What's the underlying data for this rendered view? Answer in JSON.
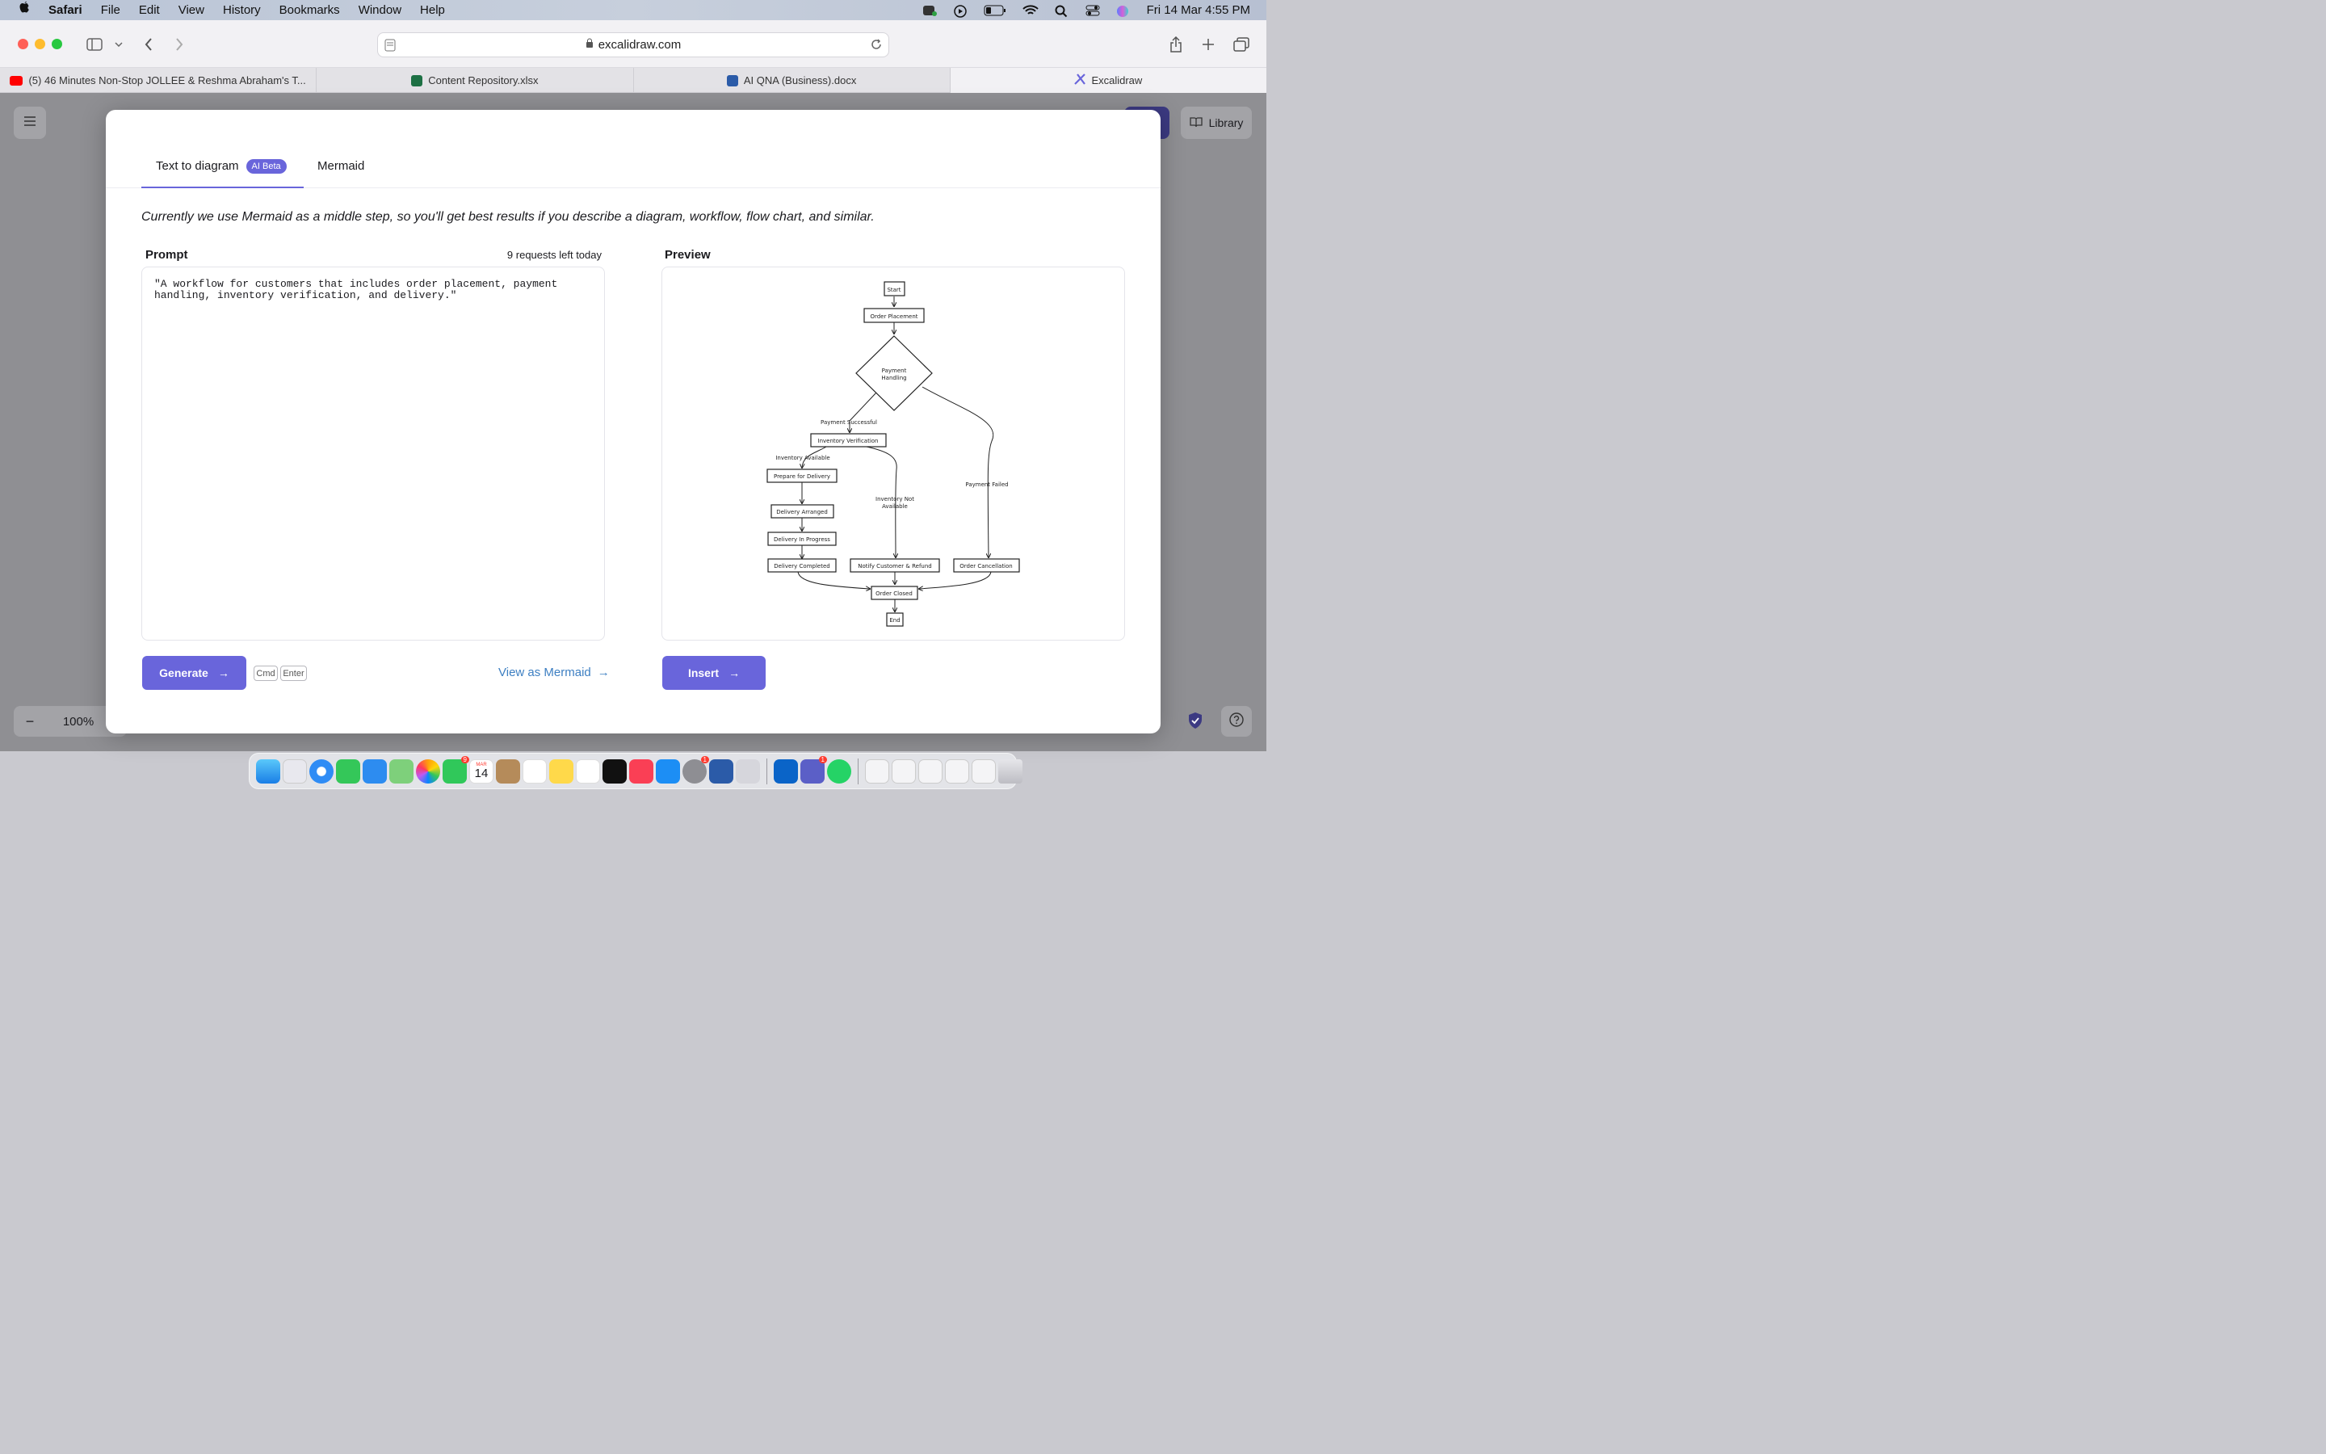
{
  "menubar": {
    "app": "Safari",
    "items": [
      "File",
      "Edit",
      "View",
      "History",
      "Bookmarks",
      "Window",
      "Help"
    ],
    "datetime": "Fri 14 Mar  4:55 PM"
  },
  "browser": {
    "url": "excalidraw.com",
    "tabs": [
      {
        "label": "(5) 46 Minutes Non-Stop JOLLEE & Reshma Abraham's T...",
        "icon": "youtube-icon"
      },
      {
        "label": "Content Repository.xlsx",
        "icon": "excel-icon"
      },
      {
        "label": "AI QNA (Business).docx",
        "icon": "word-icon"
      },
      {
        "label": "Excalidraw",
        "icon": "excalidraw-icon"
      }
    ]
  },
  "canvas": {
    "library_label": "Library",
    "zoom": "100%",
    "zoom_minus": "−"
  },
  "dialog": {
    "tab_text_to_diagram": "Text to diagram",
    "tab_badge": "AI Beta",
    "tab_mermaid": "Mermaid",
    "description": "Currently we use Mermaid as a middle step, so you'll get best results if you describe a diagram, workflow, flow chart, and similar.",
    "prompt_label": "Prompt",
    "requests_left": "9 requests left today",
    "prompt_value": "\"A workflow for customers that includes order placement, payment handling, inventory verification, and delivery.\"",
    "preview_label": "Preview",
    "generate_label": "Generate",
    "kbd_cmd": "Cmd",
    "kbd_enter": "Enter",
    "view_as_mermaid": "View as Mermaid",
    "insert_label": "Insert",
    "arrow": "→"
  },
  "diagram": {
    "start": "Start",
    "order_placement": "Order Placement",
    "payment_handling_1": "Payment",
    "payment_handling_2": "Handling",
    "payment_successful": "Payment Successful",
    "payment_failed": "Payment Failed",
    "inventory_verification": "Inventory Verification",
    "inventory_available": "Inventory Available",
    "inventory_not_available_1": "Inventory Not",
    "inventory_not_available_2": "Available",
    "prepare_for_delivery": "Prepare for Delivery",
    "delivery_arranged": "Delivery Arranged",
    "delivery_in_progress": "Delivery In Progress",
    "delivery_completed": "Delivery Completed",
    "notify_customer_refund": "Notify Customer & Refund",
    "order_cancellation": "Order Cancellation",
    "order_closed": "Order Closed",
    "end": "End"
  },
  "dock": {
    "calendar_month": "MAR",
    "calendar_day": "14",
    "facetime_badge": "9",
    "settings_badge": "1",
    "teams_badge": "1"
  },
  "colors": {
    "accent": "#6965db",
    "link": "#3d7fc2"
  }
}
